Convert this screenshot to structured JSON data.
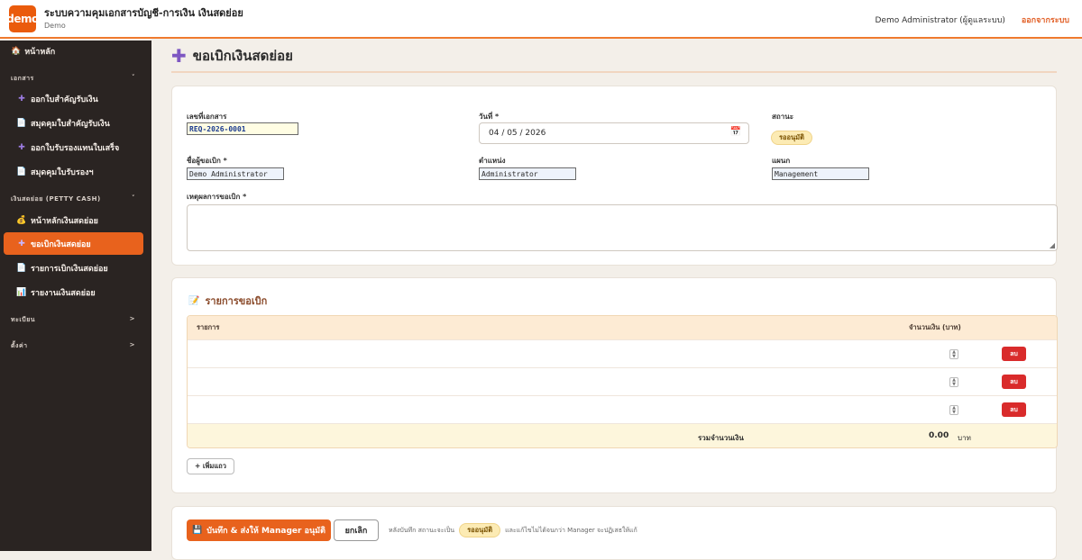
{
  "app": {
    "logo_text": "demo",
    "title": "ระบบความคุมเอกสารบัญชี-การเงิน เงินสดย่อย",
    "subtitle": "Demo",
    "user": "Demo Administrator (ผู้ดูแลระบบ)",
    "logout": "ออกจากระบบ",
    "accent_color": "#e8621d"
  },
  "sidebar": {
    "home": "หน้าหลัก",
    "sections": [
      {
        "label": "เอกสาร",
        "toggle": "˅"
      },
      {
        "label": "เงินสดย่อย (PETTY CASH)",
        "toggle": "˅"
      },
      {
        "label": "ทะเบียน",
        "toggle": ">"
      },
      {
        "label": "ตั้งค่า",
        "toggle": ">"
      }
    ],
    "items": [
      {
        "label": "ออกใบสำคัญรับเงิน",
        "icon": "plus-icon"
      },
      {
        "label": "สมุดคุมใบสำคัญรับเงิน",
        "icon": "document-icon"
      },
      {
        "label": "ออกใบรับรองแทนใบเสร็จ",
        "icon": "plus-icon"
      },
      {
        "label": "สมุดคุมใบรับรองฯ",
        "icon": "document-icon"
      },
      {
        "label": "หน้าหลักเงินสดย่อย",
        "icon": "money-bag-icon"
      },
      {
        "label": "ขอเบิกเงินสดย่อย",
        "icon": "plus-icon"
      },
      {
        "label": "รายการเบิกเงินสดย่อย",
        "icon": "document-icon"
      },
      {
        "label": "รายงานเงินสดย่อย",
        "icon": "bar-chart-icon"
      }
    ]
  },
  "page": {
    "title": "ขอเบิกเงินสดย่อย"
  },
  "form": {
    "doc_no_label": "เลขที่เอกสาร",
    "doc_no": "REQ-2026-0001",
    "date_label": "วันที่ *",
    "date": "04 / 05 / 2026",
    "status_label": "สถานะ",
    "status": "รออนุมัติ",
    "requester_label": "ชื่อผู้ขอเบิก *",
    "requester": "Demo Administrator",
    "position_label": "ตำแหน่ง",
    "position": "Administrator",
    "department_label": "แผนก",
    "department": "Management",
    "reason_label": "เหตุผลการขอเบิก *",
    "reason": ""
  },
  "items_card": {
    "title": "รายการขอเบิก",
    "col_item": "รายการ",
    "col_amount": "จำนวนเงิน (บาท)",
    "rows": [
      {
        "item": "",
        "amount": "",
        "delete": "ลบ"
      },
      {
        "item": "",
        "amount": "",
        "delete": "ลบ"
      },
      {
        "item": "",
        "amount": "",
        "delete": "ลบ"
      }
    ],
    "total_label": "รวมจำนวนเงิน",
    "total_value": "0.00",
    "total_unit": "บาท",
    "add_row": "+ เพิ่มแถว"
  },
  "actions": {
    "save": "บันทึก & ส่งให้ Manager อนุมัติ",
    "cancel": "ยกเลิก",
    "note_prefix": "หลังบันทึก สถานะจะเป็น",
    "note_badge": "รออนุมัติ",
    "note_suffix": "และแก้ไขไม่ได้จนกว่า Manager จะปฏิเสธให้แก้"
  }
}
